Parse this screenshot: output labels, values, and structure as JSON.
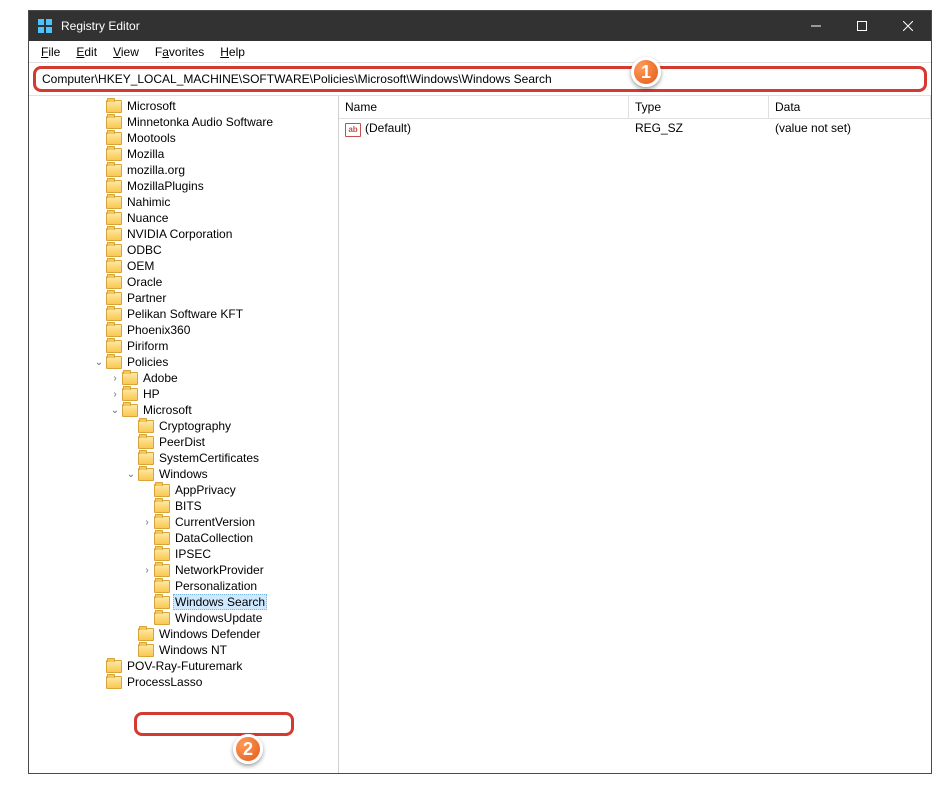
{
  "window": {
    "title": "Registry Editor"
  },
  "menubar": [
    {
      "label": "File",
      "u": 0
    },
    {
      "label": "Edit",
      "u": 0
    },
    {
      "label": "View",
      "u": 0
    },
    {
      "label": "Favorites",
      "u": 1
    },
    {
      "label": "Help",
      "u": 0
    }
  ],
  "address": "Computer\\HKEY_LOCAL_MACHINE\\SOFTWARE\\Policies\\Microsoft\\Windows\\Windows Search",
  "tree": [
    {
      "d": 4,
      "exp": null,
      "label": "Microsoft"
    },
    {
      "d": 4,
      "exp": null,
      "label": "Minnetonka Audio Software"
    },
    {
      "d": 4,
      "exp": null,
      "label": "Mootools"
    },
    {
      "d": 4,
      "exp": null,
      "label": "Mozilla"
    },
    {
      "d": 4,
      "exp": null,
      "label": "mozilla.org"
    },
    {
      "d": 4,
      "exp": null,
      "label": "MozillaPlugins"
    },
    {
      "d": 4,
      "exp": null,
      "label": "Nahimic"
    },
    {
      "d": 4,
      "exp": null,
      "label": "Nuance"
    },
    {
      "d": 4,
      "exp": null,
      "label": "NVIDIA Corporation"
    },
    {
      "d": 4,
      "exp": null,
      "label": "ODBC"
    },
    {
      "d": 4,
      "exp": null,
      "label": "OEM"
    },
    {
      "d": 4,
      "exp": null,
      "label": "Oracle"
    },
    {
      "d": 4,
      "exp": null,
      "label": "Partner"
    },
    {
      "d": 4,
      "exp": null,
      "label": "Pelikan Software KFT"
    },
    {
      "d": 4,
      "exp": null,
      "label": "Phoenix360"
    },
    {
      "d": 4,
      "exp": null,
      "label": "Piriform"
    },
    {
      "d": 4,
      "exp": "open",
      "label": "Policies"
    },
    {
      "d": 5,
      "exp": "closed",
      "label": "Adobe"
    },
    {
      "d": 5,
      "exp": "closed",
      "label": "HP"
    },
    {
      "d": 5,
      "exp": "open",
      "label": "Microsoft"
    },
    {
      "d": 6,
      "exp": null,
      "label": "Cryptography"
    },
    {
      "d": 6,
      "exp": null,
      "label": "PeerDist"
    },
    {
      "d": 6,
      "exp": null,
      "label": "SystemCertificates"
    },
    {
      "d": 6,
      "exp": "open",
      "label": "Windows"
    },
    {
      "d": 7,
      "exp": null,
      "label": "AppPrivacy"
    },
    {
      "d": 7,
      "exp": null,
      "label": "BITS"
    },
    {
      "d": 7,
      "exp": "closed",
      "label": "CurrentVersion"
    },
    {
      "d": 7,
      "exp": null,
      "label": "DataCollection"
    },
    {
      "d": 7,
      "exp": null,
      "label": "IPSEC"
    },
    {
      "d": 7,
      "exp": "closed",
      "label": "NetworkProvider"
    },
    {
      "d": 7,
      "exp": null,
      "label": "Personalization"
    },
    {
      "d": 7,
      "exp": null,
      "label": "Windows Search",
      "selected": true
    },
    {
      "d": 7,
      "exp": null,
      "label": "WindowsUpdate"
    },
    {
      "d": 6,
      "exp": null,
      "label": "Windows Defender"
    },
    {
      "d": 6,
      "exp": null,
      "label": "Windows NT"
    },
    {
      "d": 4,
      "exp": null,
      "label": "POV-Ray-Futuremark"
    },
    {
      "d": 4,
      "exp": null,
      "label": "ProcessLasso"
    }
  ],
  "values": {
    "headers": {
      "name": "Name",
      "type": "Type",
      "data": "Data"
    },
    "rows": [
      {
        "icon": "ab",
        "name": "(Default)",
        "type": "REG_SZ",
        "data": "(value not set)"
      }
    ]
  },
  "callouts": {
    "c1": "1",
    "c2": "2"
  }
}
